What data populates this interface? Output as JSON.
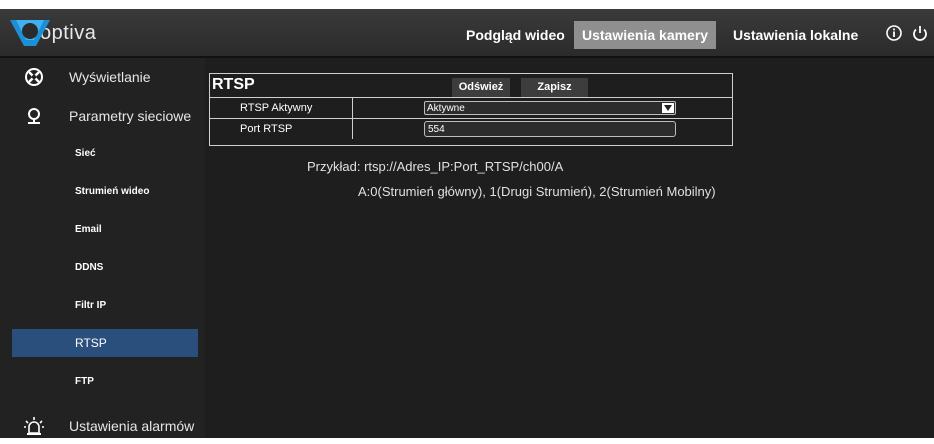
{
  "header": {
    "logo_text": "optiva",
    "nav": [
      {
        "label": "Podgląd wideo",
        "active": false
      },
      {
        "label": "Ustawienia kamery",
        "active": true
      },
      {
        "label": "Ustawienia lokalne",
        "active": false
      }
    ],
    "icons": [
      "info-icon",
      "power-icon"
    ]
  },
  "sidebar": {
    "main_items": [
      {
        "label": "Wyświetlanie",
        "icon": "display-settings-icon"
      },
      {
        "label": "Parametry sieciowe",
        "icon": "network-icon"
      },
      {
        "label": "Ustawienia alarmów",
        "icon": "alarm-light-icon"
      }
    ],
    "sub_items": [
      {
        "label": "Sieć",
        "active": false
      },
      {
        "label": "Strumień wideo",
        "active": false
      },
      {
        "label": "Email",
        "active": false
      },
      {
        "label": "DDNS",
        "active": false
      },
      {
        "label": "Filtr IP",
        "active": false
      },
      {
        "label": "RTSP",
        "active": true
      },
      {
        "label": "FTP",
        "active": false
      }
    ]
  },
  "panel": {
    "title": "RTSP",
    "refresh_label": "Odśwież",
    "save_label": "Zapisz",
    "rows": [
      {
        "label": "RTSP Aktywny",
        "type": "select",
        "value": "Aktywne"
      },
      {
        "label": "Port RTSP",
        "type": "input",
        "value": "554"
      }
    ]
  },
  "hints": {
    "example": "Przykład: rtsp://Adres_IP:Port_RTSP/ch00/A",
    "streams": "A:0(Strumień główny), 1(Drugi Strumień), 2(Strumień Mobilny)"
  },
  "colors": {
    "accent_blue": "#2a4f7c",
    "logo_blue": "#1d8fd6",
    "active_tab": "#8f8f8f",
    "background": "#1a1a1a"
  }
}
